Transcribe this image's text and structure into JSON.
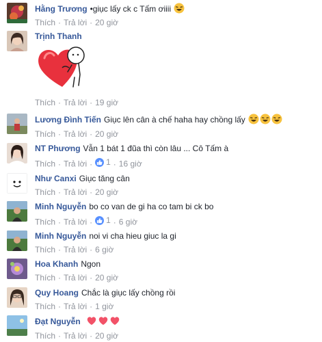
{
  "colors": {
    "author": "#365899",
    "meta": "#90949c",
    "like_badge": "#5890ff",
    "heart": "#f25268",
    "emoji_face": "#f7c23e"
  },
  "actions": {
    "like": "Thích",
    "reply": "Trả lời",
    "sep": "·"
  },
  "comments": [
    {
      "author": "Hằng Trương",
      "text": "•giục lấy ck c Tấm ơiiii",
      "emoji": [
        "laughing-emoji"
      ],
      "time": "20 giờ",
      "avatar": "avatar-red-floral"
    },
    {
      "author": "Trịnh Thanh",
      "text": "",
      "sticker": "heart-hug-sticker",
      "time": "19 giờ",
      "avatar": "avatar-woman-photo"
    },
    {
      "author": "Lương Đình Tiến",
      "text": "Giục lên cân à chế haha hay chồng lấy",
      "emoji": [
        "laughing-emoji",
        "laughing-emoji",
        "laughing-emoji"
      ],
      "time": "20 giờ",
      "avatar": "avatar-outdoor"
    },
    {
      "author": "NT Phương",
      "text": "Vẫn 1 bát 1 đũa thì còn lâu ... Cô Tấm à",
      "likes": "1",
      "time": "16 giờ",
      "avatar": "avatar-woman-selfie"
    },
    {
      "author": "Như Canxi",
      "text": "Giục tăng cân",
      "time": "20 giờ",
      "avatar": "avatar-cartoon-face"
    },
    {
      "author": "Minh Nguyễn",
      "text": "bo co van de gi ha co tam bi ck bo",
      "likes": "1",
      "time": "6 giờ",
      "avatar": "avatar-man-green"
    },
    {
      "author": "Minh Nguyễn",
      "text": "noi vi cha hieu giuc la gi",
      "time": "6 giờ",
      "avatar": "avatar-man-green"
    },
    {
      "author": "Hoa Khanh",
      "text": "Ngon",
      "time": "20 giờ",
      "avatar": "avatar-purple-flower"
    },
    {
      "author": "Quy Hoang",
      "text": "Chắc là giục lấy chồng rồi",
      "time": "1 giờ",
      "avatar": "avatar-woman-glasses"
    },
    {
      "author": "Đạt Nguyễn",
      "text": "",
      "emoji": [
        "heart-emoji",
        "heart-emoji",
        "heart-emoji"
      ],
      "time": "20 giờ",
      "avatar": "avatar-sky"
    }
  ]
}
